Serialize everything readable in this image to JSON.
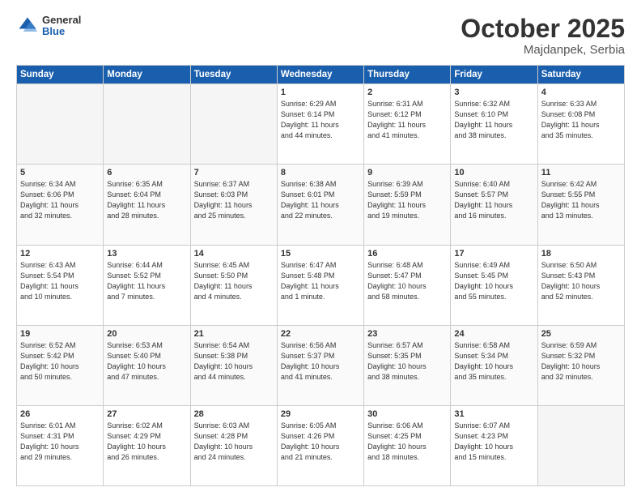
{
  "header": {
    "logo": {
      "general": "General",
      "blue": "Blue"
    },
    "title": "October 2025",
    "location": "Majdanpek, Serbia"
  },
  "weekdays": [
    "Sunday",
    "Monday",
    "Tuesday",
    "Wednesday",
    "Thursday",
    "Friday",
    "Saturday"
  ],
  "weeks": [
    [
      {
        "day": "",
        "info": ""
      },
      {
        "day": "",
        "info": ""
      },
      {
        "day": "",
        "info": ""
      },
      {
        "day": "1",
        "info": "Sunrise: 6:29 AM\nSunset: 6:14 PM\nDaylight: 11 hours\nand 44 minutes."
      },
      {
        "day": "2",
        "info": "Sunrise: 6:31 AM\nSunset: 6:12 PM\nDaylight: 11 hours\nand 41 minutes."
      },
      {
        "day": "3",
        "info": "Sunrise: 6:32 AM\nSunset: 6:10 PM\nDaylight: 11 hours\nand 38 minutes."
      },
      {
        "day": "4",
        "info": "Sunrise: 6:33 AM\nSunset: 6:08 PM\nDaylight: 11 hours\nand 35 minutes."
      }
    ],
    [
      {
        "day": "5",
        "info": "Sunrise: 6:34 AM\nSunset: 6:06 PM\nDaylight: 11 hours\nand 32 minutes."
      },
      {
        "day": "6",
        "info": "Sunrise: 6:35 AM\nSunset: 6:04 PM\nDaylight: 11 hours\nand 28 minutes."
      },
      {
        "day": "7",
        "info": "Sunrise: 6:37 AM\nSunset: 6:03 PM\nDaylight: 11 hours\nand 25 minutes."
      },
      {
        "day": "8",
        "info": "Sunrise: 6:38 AM\nSunset: 6:01 PM\nDaylight: 11 hours\nand 22 minutes."
      },
      {
        "day": "9",
        "info": "Sunrise: 6:39 AM\nSunset: 5:59 PM\nDaylight: 11 hours\nand 19 minutes."
      },
      {
        "day": "10",
        "info": "Sunrise: 6:40 AM\nSunset: 5:57 PM\nDaylight: 11 hours\nand 16 minutes."
      },
      {
        "day": "11",
        "info": "Sunrise: 6:42 AM\nSunset: 5:55 PM\nDaylight: 11 hours\nand 13 minutes."
      }
    ],
    [
      {
        "day": "12",
        "info": "Sunrise: 6:43 AM\nSunset: 5:54 PM\nDaylight: 11 hours\nand 10 minutes."
      },
      {
        "day": "13",
        "info": "Sunrise: 6:44 AM\nSunset: 5:52 PM\nDaylight: 11 hours\nand 7 minutes."
      },
      {
        "day": "14",
        "info": "Sunrise: 6:45 AM\nSunset: 5:50 PM\nDaylight: 11 hours\nand 4 minutes."
      },
      {
        "day": "15",
        "info": "Sunrise: 6:47 AM\nSunset: 5:48 PM\nDaylight: 11 hours\nand 1 minute."
      },
      {
        "day": "16",
        "info": "Sunrise: 6:48 AM\nSunset: 5:47 PM\nDaylight: 10 hours\nand 58 minutes."
      },
      {
        "day": "17",
        "info": "Sunrise: 6:49 AM\nSunset: 5:45 PM\nDaylight: 10 hours\nand 55 minutes."
      },
      {
        "day": "18",
        "info": "Sunrise: 6:50 AM\nSunset: 5:43 PM\nDaylight: 10 hours\nand 52 minutes."
      }
    ],
    [
      {
        "day": "19",
        "info": "Sunrise: 6:52 AM\nSunset: 5:42 PM\nDaylight: 10 hours\nand 50 minutes."
      },
      {
        "day": "20",
        "info": "Sunrise: 6:53 AM\nSunset: 5:40 PM\nDaylight: 10 hours\nand 47 minutes."
      },
      {
        "day": "21",
        "info": "Sunrise: 6:54 AM\nSunset: 5:38 PM\nDaylight: 10 hours\nand 44 minutes."
      },
      {
        "day": "22",
        "info": "Sunrise: 6:56 AM\nSunset: 5:37 PM\nDaylight: 10 hours\nand 41 minutes."
      },
      {
        "day": "23",
        "info": "Sunrise: 6:57 AM\nSunset: 5:35 PM\nDaylight: 10 hours\nand 38 minutes."
      },
      {
        "day": "24",
        "info": "Sunrise: 6:58 AM\nSunset: 5:34 PM\nDaylight: 10 hours\nand 35 minutes."
      },
      {
        "day": "25",
        "info": "Sunrise: 6:59 AM\nSunset: 5:32 PM\nDaylight: 10 hours\nand 32 minutes."
      }
    ],
    [
      {
        "day": "26",
        "info": "Sunrise: 6:01 AM\nSunset: 4:31 PM\nDaylight: 10 hours\nand 29 minutes."
      },
      {
        "day": "27",
        "info": "Sunrise: 6:02 AM\nSunset: 4:29 PM\nDaylight: 10 hours\nand 26 minutes."
      },
      {
        "day": "28",
        "info": "Sunrise: 6:03 AM\nSunset: 4:28 PM\nDaylight: 10 hours\nand 24 minutes."
      },
      {
        "day": "29",
        "info": "Sunrise: 6:05 AM\nSunset: 4:26 PM\nDaylight: 10 hours\nand 21 minutes."
      },
      {
        "day": "30",
        "info": "Sunrise: 6:06 AM\nSunset: 4:25 PM\nDaylight: 10 hours\nand 18 minutes."
      },
      {
        "day": "31",
        "info": "Sunrise: 6:07 AM\nSunset: 4:23 PM\nDaylight: 10 hours\nand 15 minutes."
      },
      {
        "day": "",
        "info": ""
      }
    ]
  ]
}
